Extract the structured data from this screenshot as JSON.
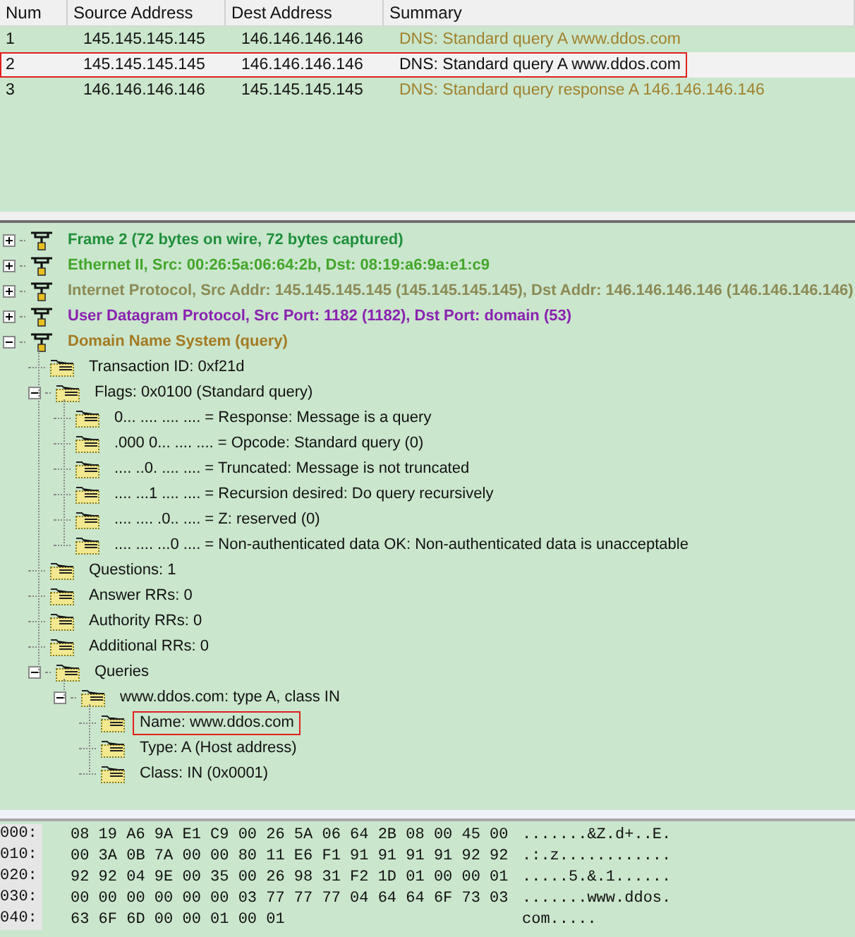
{
  "packet_list": {
    "columns": [
      "Num",
      "Source Address",
      "Dest Address",
      "Summary"
    ],
    "rows": [
      {
        "num": "1",
        "source": "145.145.145.145",
        "dest": "146.146.146.146",
        "summary": "DNS: Standard query A www.ddos.com",
        "selected": false,
        "highlighted": false
      },
      {
        "num": "2",
        "source": "145.145.145.145",
        "dest": "146.146.146.146",
        "summary": "DNS: Standard query A www.ddos.com",
        "selected": true,
        "highlighted": true
      },
      {
        "num": "3",
        "source": "146.146.146.146",
        "dest": "145.145.145.145",
        "summary": "DNS: Standard query response A 146.146.146.146",
        "selected": false,
        "highlighted": false
      }
    ]
  },
  "details": [
    {
      "label": "Frame 2 (72 bytes on wire, 72 bytes captured)",
      "color": "#1f8f3a",
      "expanded": false
    },
    {
      "label": "Ethernet II, Src: 00:26:5a:06:64:2b, Dst: 08:19:a6:9a:e1:c9",
      "color": "#43a62a",
      "expanded": false
    },
    {
      "label": "Internet Protocol, Src Addr: 145.145.145.145 (145.145.145.145), Dst Addr: 146.146.146.146 (146.146.146.146)",
      "color": "#8c8a55",
      "expanded": false
    },
    {
      "label": "User Datagram Protocol, Src Port: 1182 (1182), Dst Port: domain (53)",
      "color": "#8a22b0",
      "expanded": false
    },
    {
      "label": "Domain Name System (query)",
      "color": "#a47a22",
      "expanded": true,
      "children": [
        {
          "label": "Transaction ID: 0xf21d"
        },
        {
          "label": "Flags: 0x0100 (Standard query)",
          "expanded": true,
          "children": [
            {
              "label": "0... .... .... .... = Response: Message is a query"
            },
            {
              "label": ".000 0... .... .... = Opcode: Standard query (0)"
            },
            {
              "label": ".... ..0. .... .... = Truncated: Message is not truncated"
            },
            {
              "label": ".... ...1 .... .... = Recursion desired: Do query recursively"
            },
            {
              "label": ".... .... .0.. .... = Z: reserved (0)"
            },
            {
              "label": ".... .... ...0 .... = Non-authenticated data OK: Non-authenticated data is unacceptable"
            }
          ]
        },
        {
          "label": "Questions: 1"
        },
        {
          "label": "Answer RRs: 0"
        },
        {
          "label": "Authority RRs: 0"
        },
        {
          "label": "Additional RRs: 0"
        },
        {
          "label": "Queries",
          "expanded": true,
          "children": [
            {
              "label": "www.ddos.com: type A, class IN",
              "expanded": true,
              "children": [
                {
                  "label": "Name: www.ddos.com",
                  "highlighted": true
                },
                {
                  "label": "Type: A (Host address)"
                },
                {
                  "label": "Class: IN (0x0001)"
                }
              ]
            }
          ]
        }
      ]
    }
  ],
  "hex_dump": [
    {
      "offset": "000:",
      "bytes": "08 19 A6 9A E1 C9 00 26 5A 06 64 2B 08 00 45 00",
      "ascii": ".......&Z.d+..E."
    },
    {
      "offset": "010:",
      "bytes": "00 3A 0B 7A 00 00 80 11 E6 F1 91 91 91 91 92 92",
      "ascii": ".:.z............"
    },
    {
      "offset": "020:",
      "bytes": "92 92 04 9E 00 35 00 26 98 31 F2 1D 01 00 00 01",
      "ascii": ".....5.&.1......"
    },
    {
      "offset": "030:",
      "bytes": "00 00 00 00 00 00 03 77 77 77 04 64 64 6F 73 03",
      "ascii": ".......www.ddos."
    },
    {
      "offset": "040:",
      "bytes": "63 6F 6D 00 00 01 00 01",
      "ascii": "com....."
    }
  ]
}
